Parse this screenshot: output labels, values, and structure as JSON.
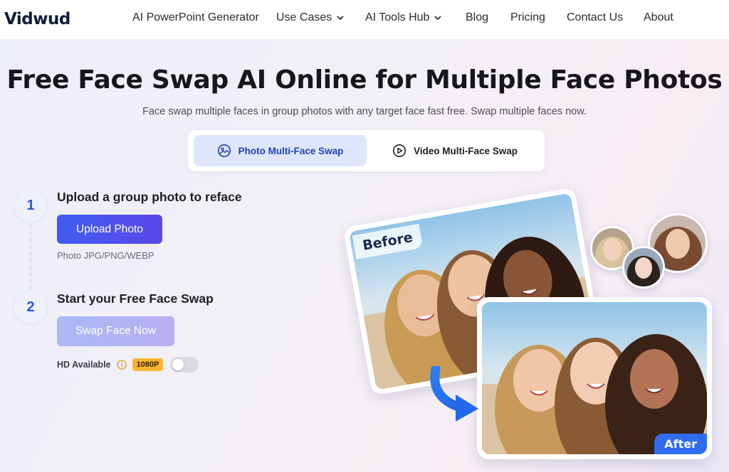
{
  "nav": {
    "logo": "Vidwud",
    "items": [
      {
        "label": "AI PowerPoint Generator"
      },
      {
        "label": "Use Cases"
      },
      {
        "label": "AI Tools Hub"
      },
      {
        "label": "Blog"
      },
      {
        "label": "Pricing"
      },
      {
        "label": "Contact Us"
      },
      {
        "label": "About"
      }
    ]
  },
  "hero": {
    "title": "Free Face Swap AI Online for Multiple Face Photos",
    "subtitle": "Face swap multiple faces in group photos with any target face fast free. Swap multiple faces now."
  },
  "tabs": [
    {
      "label": "Photo Multi-Face Swap",
      "icon": "image-icon",
      "active": true
    },
    {
      "label": "Video Multi-Face Swap",
      "icon": "play-icon",
      "active": false
    }
  ],
  "steps": [
    {
      "number": "1",
      "title": "Upload a group photo to reface",
      "button": "Upload Photo",
      "note": "Photo JPG/PNG/WEBP"
    },
    {
      "number": "2",
      "title": "Start your Free Face Swap",
      "button": "Swap Face Now"
    }
  ],
  "hd": {
    "label": "HD Available",
    "badge": "1080P",
    "enabled": false
  },
  "illustration": {
    "before_label": "Before",
    "after_label": "After"
  },
  "colors": {
    "accent": "#3f5df0",
    "tab_active_bg": "#dfe6fb",
    "badge": "#f7b632",
    "after_label_bg": "#2f6cf0"
  }
}
